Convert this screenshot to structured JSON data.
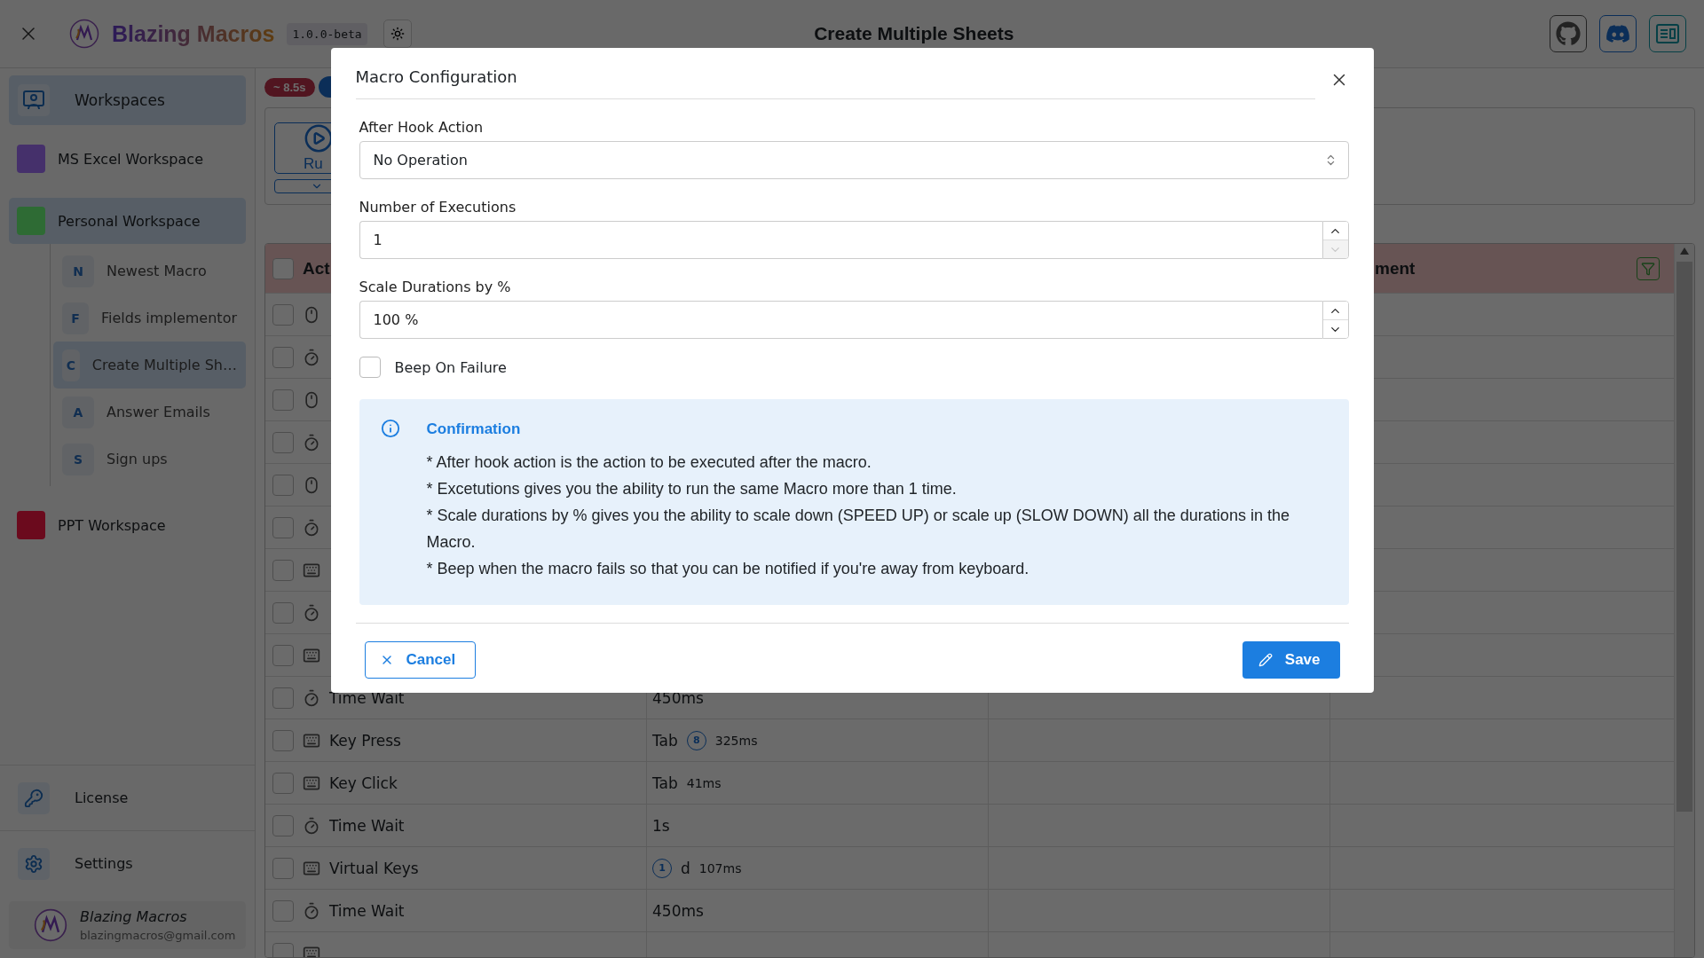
{
  "app": {
    "brand": "Blazing Macros",
    "version": "1.0.0-beta",
    "page_title": "Create Multiple Sheets"
  },
  "sidebar": {
    "workspaces_label": "Workspaces",
    "workspaces": [
      {
        "name": "MS Excel Workspace",
        "color": "#45306b",
        "selected": false
      },
      {
        "name": "Personal Workspace",
        "color": "#2e6b34",
        "selected": true,
        "expanded": true,
        "children": [
          {
            "initial": "N",
            "name": "Newest Macro",
            "selected": false
          },
          {
            "initial": "F",
            "name": "Fields implementor",
            "selected": false
          },
          {
            "initial": "C",
            "name": "Create Multiple Sh…",
            "selected": true
          },
          {
            "initial": "A",
            "name": "Answer Emails",
            "selected": false
          },
          {
            "initial": "S",
            "name": "Sign ups",
            "selected": false
          }
        ]
      },
      {
        "name": "PPT Workspace",
        "color": "#6b0a1e",
        "selected": false
      }
    ],
    "bottom_items": [
      {
        "kind": "license",
        "label": "License"
      },
      {
        "kind": "settings",
        "label": "Settings"
      }
    ],
    "user": {
      "name": "Blazing Macros",
      "email": "blazingmacros@gmail.com"
    }
  },
  "main": {
    "duration_badge": "~ 8.5s",
    "run_label": "Ru",
    "table": {
      "all_checked": false,
      "columns": [
        "Act",
        "ment"
      ],
      "rows": [
        {
          "kind": "mouse",
          "checked": false
        },
        {
          "kind": "timer",
          "checked": false
        },
        {
          "kind": "mouse",
          "checked": false
        },
        {
          "kind": "timer",
          "checked": false
        },
        {
          "kind": "mouse",
          "checked": false
        },
        {
          "kind": "timer",
          "checked": false
        },
        {
          "kind": "keyboard",
          "checked": false
        },
        {
          "kind": "timer",
          "checked": false
        },
        {
          "kind": "keyboard",
          "checked": false
        },
        {
          "kind": "timer",
          "checked": false,
          "action": "Time Wait",
          "value": [
            {
              "kind": "text",
              "text": "450ms"
            }
          ]
        },
        {
          "kind": "keyboard",
          "checked": false,
          "action": "Key Press",
          "value": [
            {
              "kind": "text",
              "text": "Tab"
            },
            {
              "kind": "count",
              "text": "8"
            },
            {
              "kind": "small",
              "text": "325ms"
            }
          ]
        },
        {
          "kind": "keyboard",
          "checked": false,
          "action": "Key Click",
          "value": [
            {
              "kind": "text",
              "text": "Tab"
            },
            {
              "kind": "small",
              "text": "41ms"
            }
          ]
        },
        {
          "kind": "timer",
          "checked": false,
          "action": "Time Wait",
          "value": [
            {
              "kind": "text",
              "text": "1s"
            }
          ]
        },
        {
          "kind": "keyboard",
          "checked": false,
          "action": "Virtual Keys",
          "value": [
            {
              "kind": "count",
              "text": "1"
            },
            {
              "kind": "text",
              "text": "d"
            },
            {
              "kind": "small",
              "text": "107ms"
            }
          ]
        },
        {
          "kind": "timer",
          "checked": false,
          "action": "Time Wait",
          "value": [
            {
              "kind": "text",
              "text": "450ms"
            }
          ]
        },
        {
          "kind": "keyboard",
          "checked": false
        }
      ]
    }
  },
  "modal": {
    "title": "Macro Configuration",
    "select": {
      "label": "After Hook Action",
      "value": "No Operation"
    },
    "number_fields": [
      {
        "label": "Number of Executions",
        "value": "1",
        "down_disabled": true
      },
      {
        "label": "Scale Durations by %",
        "value": "100 %",
        "down_disabled": false
      }
    ],
    "checkbox": {
      "label": "Beep On Failure",
      "checked": false
    },
    "alert": {
      "title": "Confirmation",
      "lines": [
        "* After hook action is the action to be executed after the macro.",
        "* Excetutions gives you the ability to run the same Macro more than 1 time.",
        "* Scale durations by % gives you the ability to scale down (SPEED UP) or scale up (SLOW DOWN) all the durations in the Macro.",
        "* Beep when the macro fails so that you can be notified if you're away from keyboard."
      ]
    },
    "cancel_label": "Cancel",
    "save_label": "Save"
  }
}
